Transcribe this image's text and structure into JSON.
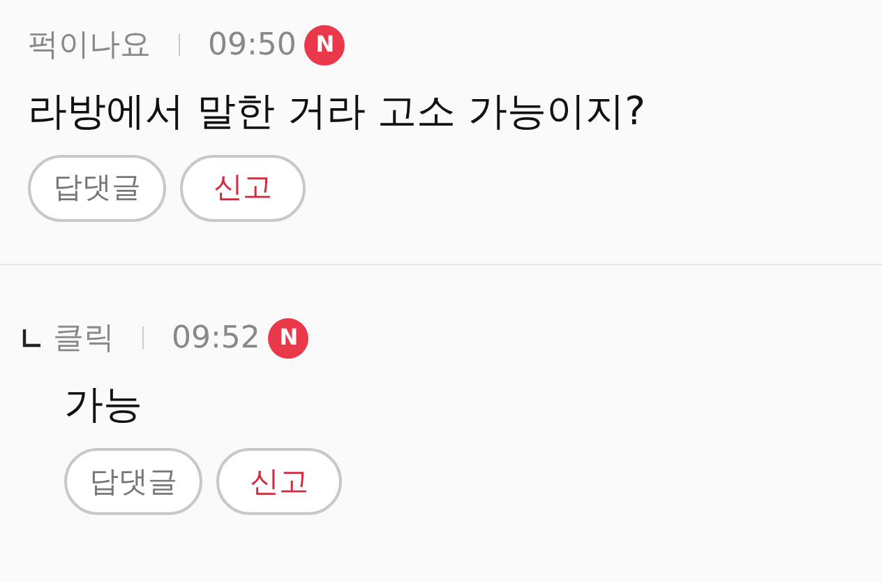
{
  "comments": [
    {
      "author": "퍽이나요",
      "time": "09:50",
      "badge": "N",
      "text": "라방에서 말한 거라 고소 가능이지?",
      "is_reply": false,
      "buttons": [
        {
          "label": "답댓글",
          "kind": "reply"
        },
        {
          "label": "신고",
          "kind": "report"
        }
      ]
    },
    {
      "author": "클릭",
      "time": "09:52",
      "badge": "N",
      "text": "가능",
      "is_reply": true,
      "buttons": [
        {
          "label": "답댓글",
          "kind": "reply"
        },
        {
          "label": "신고",
          "kind": "report"
        }
      ]
    }
  ]
}
